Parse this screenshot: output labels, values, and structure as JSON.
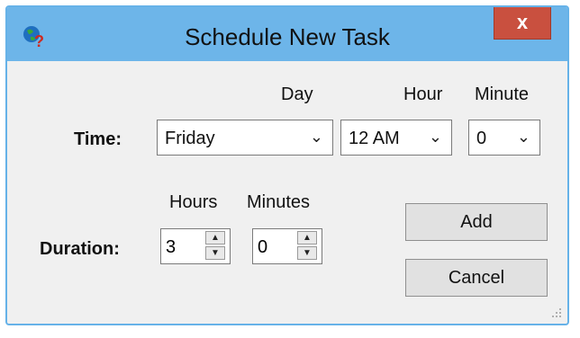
{
  "window": {
    "title": "Schedule New Task",
    "close_label": "x"
  },
  "time": {
    "label": "Time:",
    "day_header": "Day",
    "hour_header": "Hour",
    "minute_header": "Minute",
    "day_value": "Friday",
    "hour_value": "12 AM",
    "minute_value": "0"
  },
  "duration": {
    "label": "Duration:",
    "hours_header": "Hours",
    "minutes_header": "Minutes",
    "hours_value": "3",
    "minutes_value": "0"
  },
  "buttons": {
    "add_label": "Add",
    "cancel_label": "Cancel"
  },
  "icons": {
    "app": "globe-question-icon",
    "dropdown": "chevron-down-icon",
    "spin_up": "arrow-up-icon",
    "spin_down": "arrow-down-icon"
  },
  "colors": {
    "titlebar": "#6db5e9",
    "close_button": "#c9503f"
  }
}
